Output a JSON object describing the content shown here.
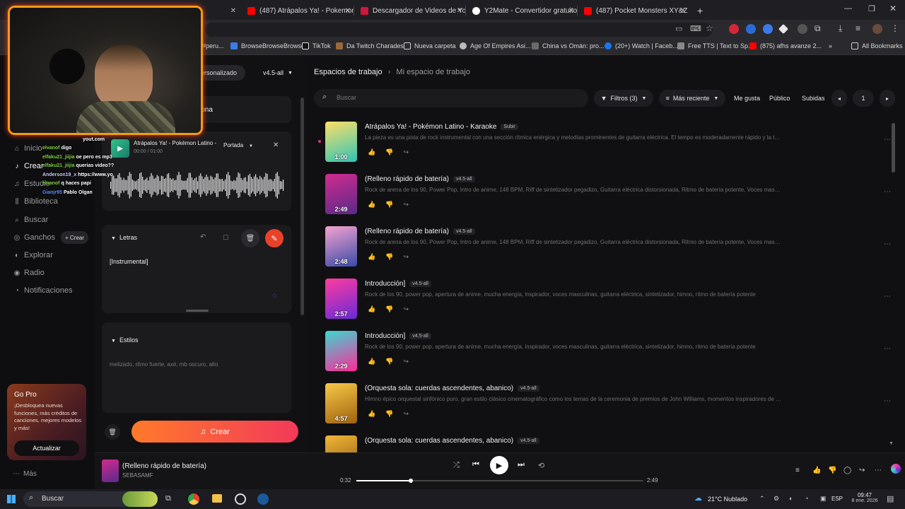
{
  "browser": {
    "tabs": [
      {
        "label": "(487) Atrápalos Ya! - Pokemon",
        "color": "#ff0000"
      },
      {
        "label": "Descargador de Videos de YouT",
        "color": "#d0163d"
      },
      {
        "label": "Y2Mate - Convertidor gratuito",
        "color": "#ffffff"
      },
      {
        "label": "(487) Pocket Monsters XY&Z O",
        "color": "#ff0000"
      }
    ],
    "new_tab": "+",
    "bookmarks": [
      {
        "label": "#peru..."
      },
      {
        "label": "BrowseBrowseBrowse"
      },
      {
        "label": "TikTok"
      },
      {
        "label": "Da Twitch Charades"
      },
      {
        "label": "Nueva carpeta"
      },
      {
        "label": "Age Of Empires Asi..."
      },
      {
        "label": "China vs Omán: pro..."
      },
      {
        "label": "(20+) Watch | Faceb..."
      },
      {
        "label": "Free TTS | Text to Sp..."
      },
      {
        "label": "(875) afhs avanze 2..."
      },
      {
        "label": "»"
      },
      {
        "label": "All Bookmarks"
      }
    ]
  },
  "webcam": {
    "source": "yout.com",
    "chat": [
      {
        "user": "elvanof",
        "msg": "digo",
        "color": "#7fd23c"
      },
      {
        "user": "elfaku21_jiijia",
        "msg": "oe pero es mp3",
        "color": "#7fd23c"
      },
      {
        "user": "elfaku21_jiijia",
        "msg": "querias video??",
        "color": "#7fd23c"
      },
      {
        "user": "Anderson19_x",
        "msg": "https://www.yo",
        "color": "#c8c8ff"
      },
      {
        "user": "elvanof",
        "msg": "q haces papi",
        "color": "#7fd23c"
      },
      {
        "user": "Gianjr95",
        "msg": "Pablo Olgan",
        "color": "#5a8cff"
      }
    ]
  },
  "sidebar": {
    "items": [
      {
        "label": "Inicio",
        "icon": "home-icon",
        "glyph": "⌂"
      },
      {
        "label": "Crear",
        "icon": "music-note-icon",
        "glyph": "♪"
      },
      {
        "label": "Estudio",
        "icon": "studio-icon",
        "glyph": "♫"
      },
      {
        "label": "Biblioteca",
        "icon": "library-icon",
        "glyph": "⫼"
      },
      {
        "label": "Buscar",
        "icon": "search-icon",
        "glyph": "⌕"
      },
      {
        "label": "Ganchos",
        "icon": "hooks-icon",
        "glyph": "◎"
      },
      {
        "label": "Explorar",
        "icon": "explore-icon",
        "glyph": "◐"
      },
      {
        "label": "Radio",
        "icon": "radio-icon",
        "glyph": "◉"
      },
      {
        "label": "Notificaciones",
        "icon": "bell-icon",
        "glyph": "◔"
      }
    ],
    "ganchos_create": "+ Crear",
    "gopro": {
      "title": "Go Pro",
      "text": "¡Desbloquea nuevas funciones, más créditos de canciones, mejores modelos y más!",
      "button": "Actualizar"
    },
    "more": "Más"
  },
  "panel": {
    "mode_tab": "ersonalizado",
    "version": "v4.5-all",
    "persona_button": "+ Persona",
    "audio": {
      "title": "Atrápalos Ya! - Pokémon Latino -",
      "time": "00:00 / 01:00",
      "cover_select": "Portada"
    },
    "lyrics": {
      "header": "Letras",
      "text": "[Instrumental]"
    },
    "styles": {
      "header": "Estilos",
      "text": "melizado, ritmo fuerte, axé, mb oscuro, alto"
    },
    "create_button": "Crear"
  },
  "main": {
    "breadcrumb": {
      "root": "Espacios de trabajo",
      "current": "Mi espacio de trabajo"
    },
    "search_placeholder": "Buscar",
    "filters": "Filtros  (3)",
    "sort": "Más reciente",
    "chips": [
      "Me gusta",
      "Público",
      "Subidas"
    ],
    "page": "1",
    "songs": [
      {
        "title": "Atrápalos Ya! - Pokémon Latino - Karaoke",
        "badge": "Subir",
        "duration": "1:00",
        "desc": "La pieza es una pista de rock instrumental con una sección rítmica enérgica y melodías prominentes de guitarra eléctrica. El tempo es moderadamente rápido y la tonalida...",
        "thumb": [
          "#ffe066",
          "#2ec4b6"
        ]
      },
      {
        "title": "(Relleno rápido de batería)",
        "badge": "v4.5-all",
        "duration": "2:49",
        "desc": "Rock de arena de los 90, Power Pop, Intro de anime, 148 BPM, Riff de sintetizador pegadizo, Guitarra eléctrica distorsionada, Ritmo de batería potente, Voces masculinas p...",
        "thumb": [
          "#d12b8f",
          "#5a2a8a"
        ]
      },
      {
        "title": "(Relleno rápido de batería)",
        "badge": "v4.5-all",
        "duration": "2:48",
        "desc": "Rock de arena de los 90, Power Pop, Intro de anime, 148 BPM, Riff de sintetizador pegadizo, Guitarra eléctrica distorsionada, Ritmo de batería potente, Voces masculinas p...",
        "thumb": [
          "#f5a3d0",
          "#3a4aa8"
        ]
      },
      {
        "title": "Introducción]",
        "badge": "v4.5-all",
        "duration": "2:57",
        "desc": "Rock de los 90, power pop, apertura de anime, mucha energía, inspirador, voces masculinas, guitarra eléctrica, sintetizador, himno, ritmo de batería potente",
        "thumb": [
          "#ff3ca0",
          "#6a2ad8"
        ]
      },
      {
        "title": "Introducción]",
        "badge": "v4.5-all",
        "duration": "2:29",
        "desc": "Rock de los 90, power pop, apertura de anime, mucha energía, inspirador, voces masculinas, guitarra eléctrica, sintetizador, himno, ritmo de batería potente",
        "thumb": [
          "#3ad8d0",
          "#ff2a9a"
        ]
      },
      {
        "title": "(Orquesta sola: cuerdas ascendentes, abanico)",
        "badge": "v4.5-all",
        "duration": "4:57",
        "desc": "Himno épico orquestal sinfónico puro, gran estilo clásico cinematográfico como los temas de la ceremonia de premios de John Williams, momentos inspiradores de Hans...",
        "thumb": [
          "#f7c948",
          "#a0620e"
        ]
      },
      {
        "title": "(Orquesta sola: cuerdas ascendentes, abanico)",
        "badge": "v4.5-all",
        "duration": "",
        "desc": "",
        "thumb": [
          "#f2b838",
          "#8a5210"
        ]
      }
    ]
  },
  "player": {
    "title": "(Relleno rápido de batería)",
    "artist": "SEBASAMF",
    "current": "0:32",
    "total": "2:49",
    "progress": 0.19
  },
  "taskbar": {
    "search": "Buscar",
    "weather": "21°C  Nublado",
    "lang": "ESP",
    "time": "09:47",
    "date": "8 ene. 2026"
  },
  "colors": {
    "accent": "#ff5a2a",
    "create_gradient": [
      "#ff7a2a",
      "#f23a5a"
    ]
  }
}
